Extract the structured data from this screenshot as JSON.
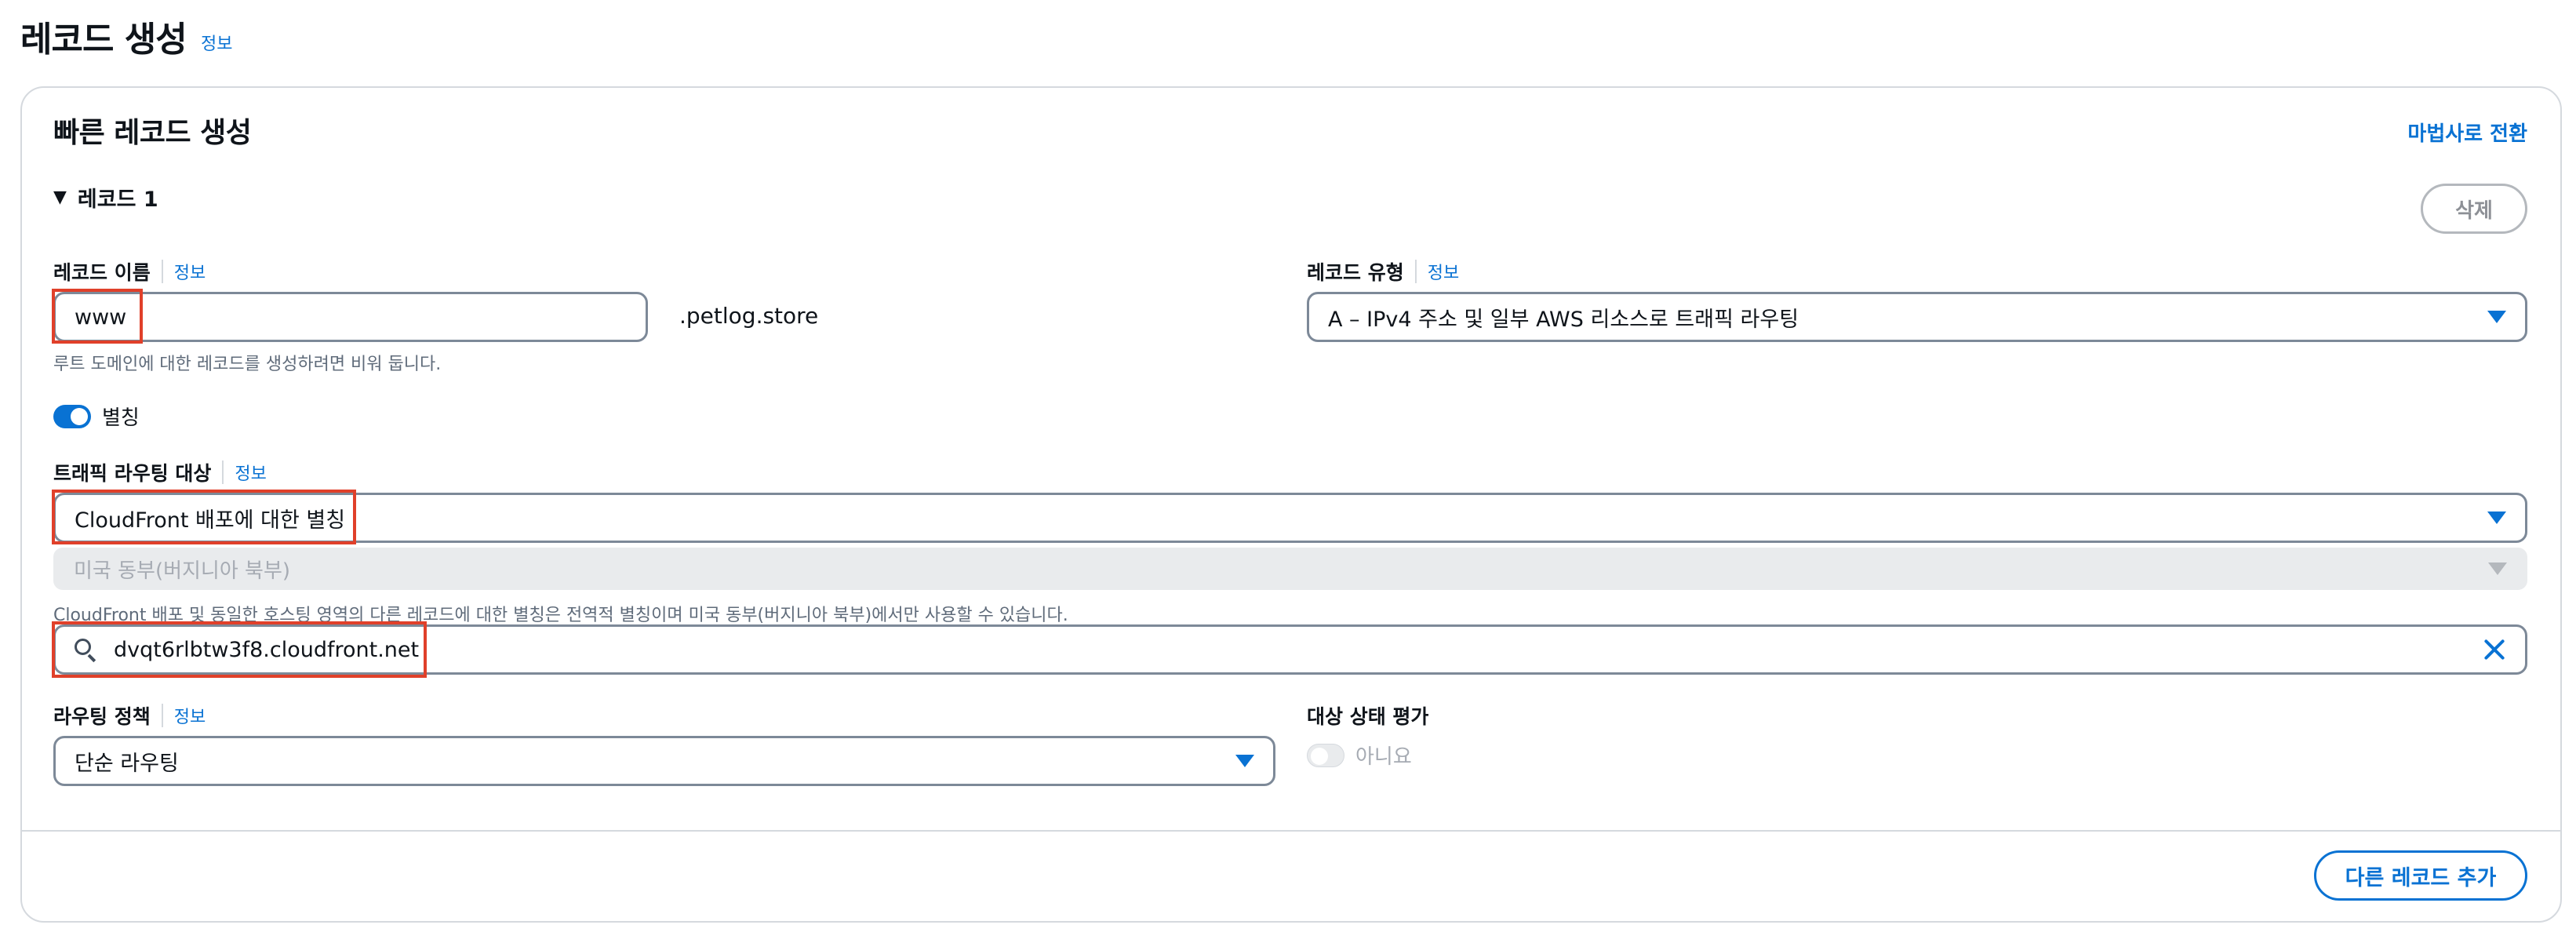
{
  "page": {
    "title": "레코드 생성",
    "info": "정보"
  },
  "quick_create": {
    "title": "빠른 레코드 생성",
    "wizard_link": "마법사로 전환",
    "record_toggle": "레코드 1",
    "delete_label": "삭제",
    "add_record_label": "다른 레코드 추가"
  },
  "record_name": {
    "label": "레코드 이름",
    "info": "정보",
    "value": "www",
    "suffix": ".petlog.store",
    "hint": "루트 도메인에 대한 레코드를 생성하려면 비워 둡니다."
  },
  "record_type": {
    "label": "레코드 유형",
    "info": "정보",
    "value": "A – IPv4 주소 및 일부 AWS 리소스로 트래픽 라우팅"
  },
  "alias": {
    "label": "별칭",
    "enabled": true
  },
  "route_traffic": {
    "label": "트래픽 라우팅 대상",
    "info": "정보",
    "endpoint": "CloudFront 배포에 대한 별칭",
    "region": "미국 동부(버지니아 북부)",
    "hint": "CloudFront 배포 및 동일한 호스팅 영역의 다른 레코드에 대한 별칭은 전역적 별칭이며 미국 동부(버지니아 북부)에서만 사용할 수 있습니다.",
    "distribution": "dvqt6rlbtw3f8.cloudfront.net"
  },
  "routing_policy": {
    "label": "라우팅 정책",
    "info": "정보",
    "value": "단순 라우팅"
  },
  "health": {
    "label": "대상 상태 평가",
    "value": "아니요",
    "enabled": false
  },
  "colors": {
    "accent": "#0972d3",
    "highlight": "#e0402a"
  }
}
